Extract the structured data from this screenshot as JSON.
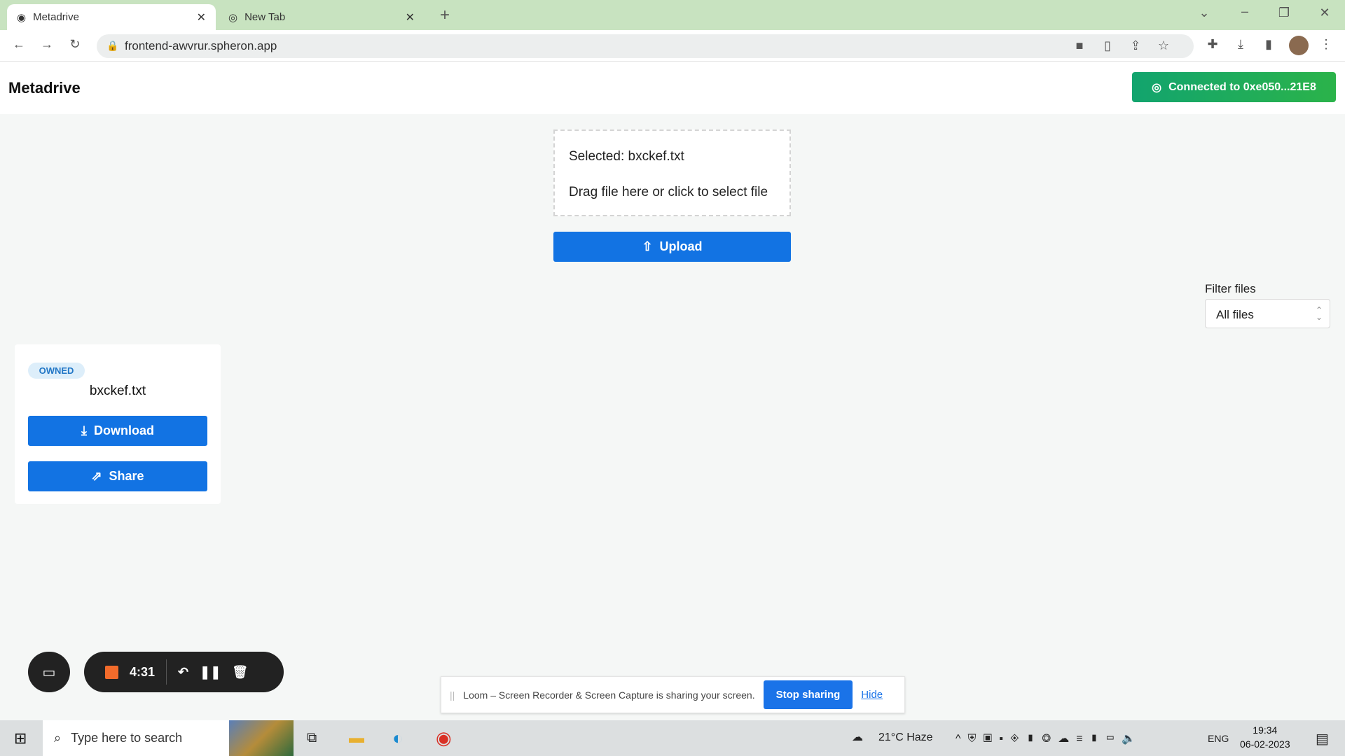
{
  "browser": {
    "tabs": [
      {
        "label": "Metadrive",
        "icon": "metadrive-icon"
      },
      {
        "label": "New Tab",
        "icon": "chrome-icon"
      }
    ],
    "url": "frontend-awvrur.spheron.app"
  },
  "app": {
    "title": "Metadrive",
    "connected_label": "Connected to 0xe050...21E8",
    "accent": "#1273e3",
    "connected_color": "#12a46e"
  },
  "upload": {
    "selected": "Selected: bxckef.txt",
    "hint": "Drag file here or click to select file",
    "button": "Upload"
  },
  "filter": {
    "label": "Filter files",
    "value": "All files"
  },
  "files": [
    {
      "badge": "OWNED",
      "name": "bxckef.txt",
      "download": "Download",
      "share": "Share"
    }
  ],
  "loom": {
    "time": "4:31",
    "message": "Loom – Screen Recorder & Screen Capture is sharing your screen.",
    "stop": "Stop sharing",
    "hide": "Hide"
  },
  "taskbar": {
    "search_placeholder": "Type here to search",
    "weather": "21°C  Haze",
    "lang": "ENG",
    "time": "19:34",
    "date": "06-02-2023"
  }
}
